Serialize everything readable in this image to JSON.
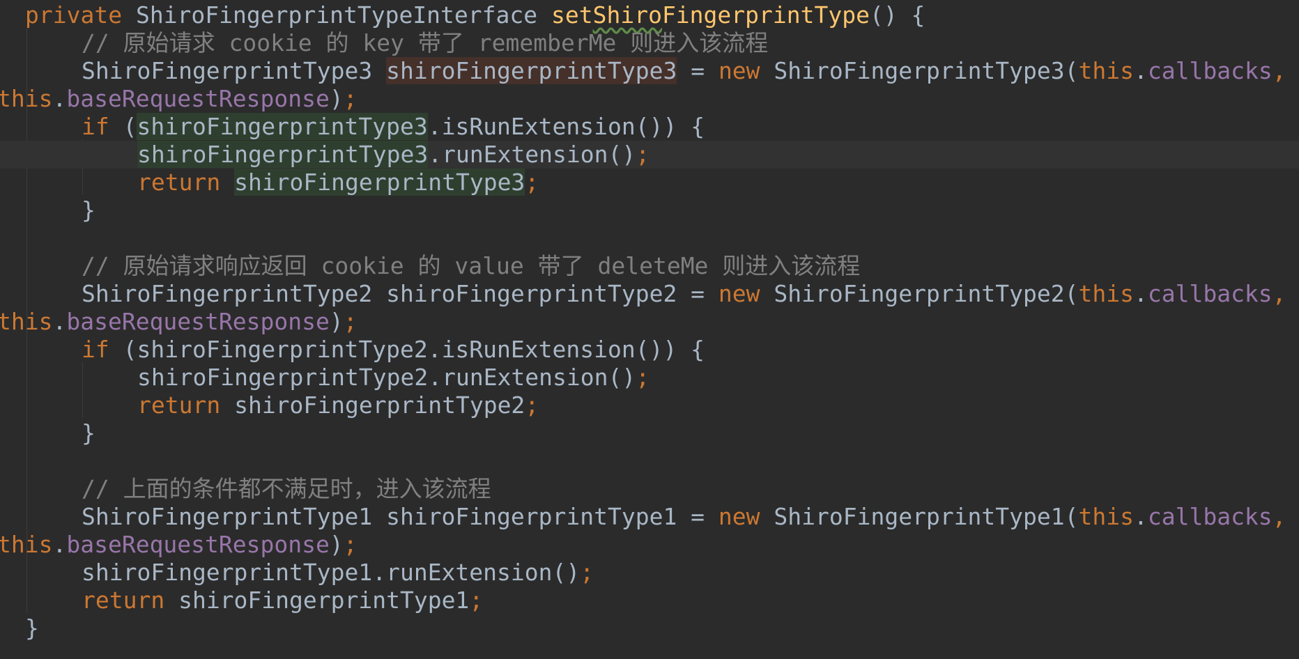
{
  "lines": [
    {
      "tokens": [
        {
          "t": "private ",
          "c": "kw"
        },
        {
          "t": "ShiroFingerprintTypeInterface ",
          "c": "pl"
        },
        {
          "t": "set",
          "c": "fn"
        },
        {
          "t": "Shiro",
          "c": "fn",
          "typo": true
        },
        {
          "t": "FingerprintType",
          "c": "fn"
        },
        {
          "t": "() {",
          "c": "pl"
        }
      ]
    },
    {
      "tokens": [
        {
          "t": "// 原始请求 cookie 的 key 带了 rememberMe 则进入该流程",
          "c": "cm"
        }
      ]
    },
    {
      "tokens": [
        {
          "t": "ShiroFingerprintType3 ",
          "c": "pl"
        },
        {
          "t": "shiroFingerprintType3",
          "c": "pl",
          "hl": "write"
        },
        {
          "t": " = ",
          "c": "pl"
        },
        {
          "t": "new ",
          "c": "kw"
        },
        {
          "t": "ShiroFingerprintType3(",
          "c": "pl"
        },
        {
          "t": "this",
          "c": "kw"
        },
        {
          "t": ".",
          "c": "pl"
        },
        {
          "t": "callbacks",
          "c": "fld"
        },
        {
          "t": ",",
          "c": "kw"
        }
      ]
    },
    {
      "tokens": [
        {
          "t": "this",
          "c": "kw"
        },
        {
          "t": ".",
          "c": "pl"
        },
        {
          "t": "baseRequestResponse",
          "c": "fld"
        },
        {
          "t": ")",
          "c": "pl"
        },
        {
          "t": ";",
          "c": "kw"
        }
      ]
    },
    {
      "tokens": [
        {
          "t": "if ",
          "c": "kw"
        },
        {
          "t": "(",
          "c": "pl"
        },
        {
          "t": "shiroFingerprintType3",
          "c": "pl",
          "hl": "read"
        },
        {
          "t": ".isRunExtension()) {",
          "c": "pl"
        }
      ]
    },
    {
      "current": true,
      "tokens": [
        {
          "t": "shiroFingerprintType3",
          "c": "pl",
          "hl": "read"
        },
        {
          "t": ".runExtension()",
          "c": "pl"
        },
        {
          "t": ";",
          "c": "kw"
        }
      ]
    },
    {
      "tokens": [
        {
          "t": "return ",
          "c": "kw"
        },
        {
          "t": "shiroFingerprintType3",
          "c": "pl",
          "hl": "read"
        },
        {
          "t": ";",
          "c": "kw"
        }
      ]
    },
    {
      "tokens": [
        {
          "t": "}",
          "c": "pl"
        }
      ]
    },
    {
      "tokens": []
    },
    {
      "tokens": [
        {
          "t": "// 原始请求响应返回 cookie 的 value 带了 deleteMe 则进入该流程",
          "c": "cm"
        }
      ]
    },
    {
      "tokens": [
        {
          "t": "ShiroFingerprintType2 shiroFingerprintType2 = ",
          "c": "pl"
        },
        {
          "t": "new ",
          "c": "kw"
        },
        {
          "t": "ShiroFingerprintType2(",
          "c": "pl"
        },
        {
          "t": "this",
          "c": "kw"
        },
        {
          "t": ".",
          "c": "pl"
        },
        {
          "t": "callbacks",
          "c": "fld"
        },
        {
          "t": ",",
          "c": "kw"
        }
      ]
    },
    {
      "tokens": [
        {
          "t": "this",
          "c": "kw"
        },
        {
          "t": ".",
          "c": "pl"
        },
        {
          "t": "baseRequestResponse",
          "c": "fld"
        },
        {
          "t": ")",
          "c": "pl"
        },
        {
          "t": ";",
          "c": "kw"
        }
      ]
    },
    {
      "tokens": [
        {
          "t": "if ",
          "c": "kw"
        },
        {
          "t": "(shiroFingerprintType2.isRunExtension()) {",
          "c": "pl"
        }
      ]
    },
    {
      "tokens": [
        {
          "t": "shiroFingerprintType2.runExtension()",
          "c": "pl"
        },
        {
          "t": ";",
          "c": "kw"
        }
      ]
    },
    {
      "tokens": [
        {
          "t": "return ",
          "c": "kw"
        },
        {
          "t": "shiroFingerprintType2",
          "c": "pl"
        },
        {
          "t": ";",
          "c": "kw"
        }
      ]
    },
    {
      "tokens": [
        {
          "t": "}",
          "c": "pl"
        }
      ]
    },
    {
      "tokens": []
    },
    {
      "tokens": [
        {
          "t": "// 上面的条件都不满足时，进入该流程",
          "c": "cm"
        }
      ]
    },
    {
      "tokens": [
        {
          "t": "ShiroFingerprintType1 shiroFingerprintType1 = ",
          "c": "pl"
        },
        {
          "t": "new ",
          "c": "kw"
        },
        {
          "t": "ShiroFingerprintType1(",
          "c": "pl"
        },
        {
          "t": "this",
          "c": "kw"
        },
        {
          "t": ".",
          "c": "pl"
        },
        {
          "t": "callbacks",
          "c": "fld"
        },
        {
          "t": ",",
          "c": "kw"
        }
      ]
    },
    {
      "tokens": [
        {
          "t": "this",
          "c": "kw"
        },
        {
          "t": ".",
          "c": "pl"
        },
        {
          "t": "baseRequestResponse",
          "c": "fld"
        },
        {
          "t": ")",
          "c": "pl"
        },
        {
          "t": ";",
          "c": "kw"
        }
      ]
    },
    {
      "tokens": [
        {
          "t": "shiroFingerprintType1.runExtension()",
          "c": "pl"
        },
        {
          "t": ";",
          "c": "kw"
        }
      ]
    },
    {
      "tokens": [
        {
          "t": "return ",
          "c": "kw"
        },
        {
          "t": "shiroFingerprintType1",
          "c": "pl"
        },
        {
          "t": ";",
          "c": "kw"
        }
      ]
    },
    {
      "tokens": [
        {
          "t": "}",
          "c": "pl"
        }
      ]
    }
  ],
  "theme": {
    "background": "#2b2b2b",
    "current_line": "#323232",
    "keyword": "#cc7832",
    "method": "#ffc66d",
    "field": "#9876aa",
    "comment": "#808080",
    "text": "#a9b7c6",
    "write_highlight": "#45302a",
    "read_highlight": "#2f3f2f"
  }
}
